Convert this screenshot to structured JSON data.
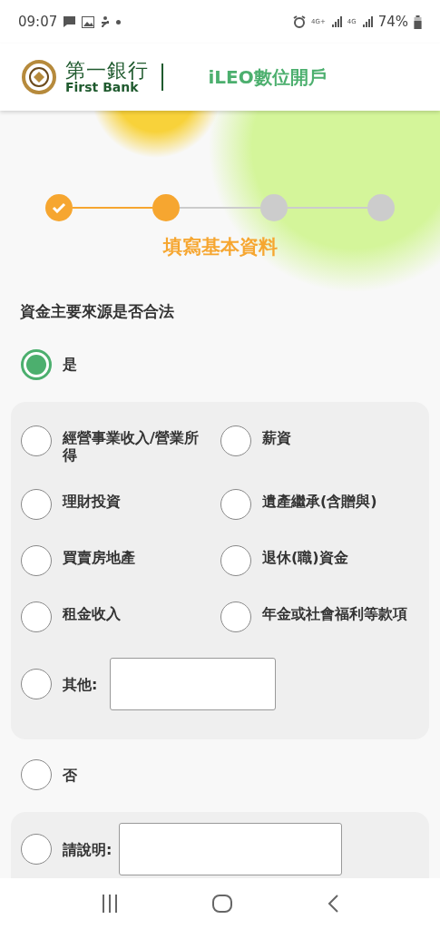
{
  "status_bar": {
    "time": "09:07",
    "network_1": "4G+",
    "network_2": "4G",
    "battery": "74%"
  },
  "header": {
    "bank_name": "第一銀行",
    "bank_name_en": "First Bank",
    "title": "iLEO數位開戶"
  },
  "steps": [
    {
      "kind": "done"
    },
    {
      "kind": "current"
    },
    {
      "kind": "todo"
    },
    {
      "kind": "todo"
    }
  ],
  "step_label": "填寫基本資料",
  "question": "資金主要來源是否合法",
  "answers": [
    {
      "label": "是",
      "selected": true,
      "sources": [
        {
          "label": "經營事業收入/營業所得",
          "selected": false,
          "kind": "plain"
        },
        {
          "label": "薪資",
          "selected": false,
          "kind": "plain"
        },
        {
          "label": "理財投資",
          "selected": false,
          "kind": "plain"
        },
        {
          "label": "遺產繼承(含贈與)",
          "selected": false,
          "kind": "plain"
        },
        {
          "label": "買賣房地產",
          "selected": false,
          "kind": "plain"
        },
        {
          "label": "退休(職)資金",
          "selected": false,
          "kind": "plain"
        },
        {
          "label": "租金收入",
          "selected": false,
          "kind": "plain"
        },
        {
          "label": "年金或社會福利等款項",
          "selected": false,
          "kind": "plain"
        },
        {
          "label": "其他:",
          "selected": false,
          "kind": "text"
        }
      ]
    },
    {
      "label": "否",
      "selected": false,
      "detail": {
        "label": "請說明:",
        "selected": false
      }
    }
  ]
}
